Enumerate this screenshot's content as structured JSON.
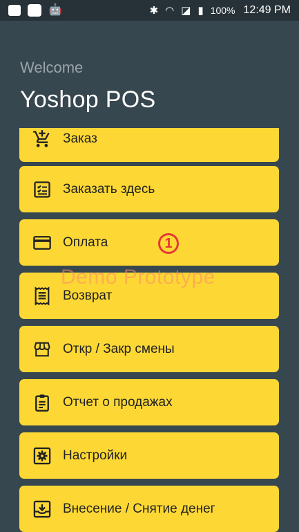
{
  "status_bar": {
    "battery_percent": "100%",
    "time": "12:49 PM"
  },
  "header": {
    "welcome": "Welcome",
    "app_title": "Yoshop POS"
  },
  "menu": [
    {
      "label": "Заказ",
      "icon": "cart-add-icon"
    },
    {
      "label": "Заказать здесь",
      "icon": "checklist-icon"
    },
    {
      "label": "Оплата",
      "icon": "credit-card-icon"
    },
    {
      "label": "Возврат",
      "icon": "receipt-icon"
    },
    {
      "label": "Откр / Закр смены",
      "icon": "store-icon"
    },
    {
      "label": "Отчет о продажах",
      "icon": "clipboard-icon"
    },
    {
      "label": "Настройки",
      "icon": "settings-icon"
    },
    {
      "label": "Внесение / Снятие денег",
      "icon": "download-tray-icon"
    }
  ],
  "overlay": {
    "watermark": "Demo Prototype",
    "marker": "1"
  },
  "colors": {
    "background": "#37474F",
    "card": "#FDD835",
    "marker": "#e53935"
  }
}
